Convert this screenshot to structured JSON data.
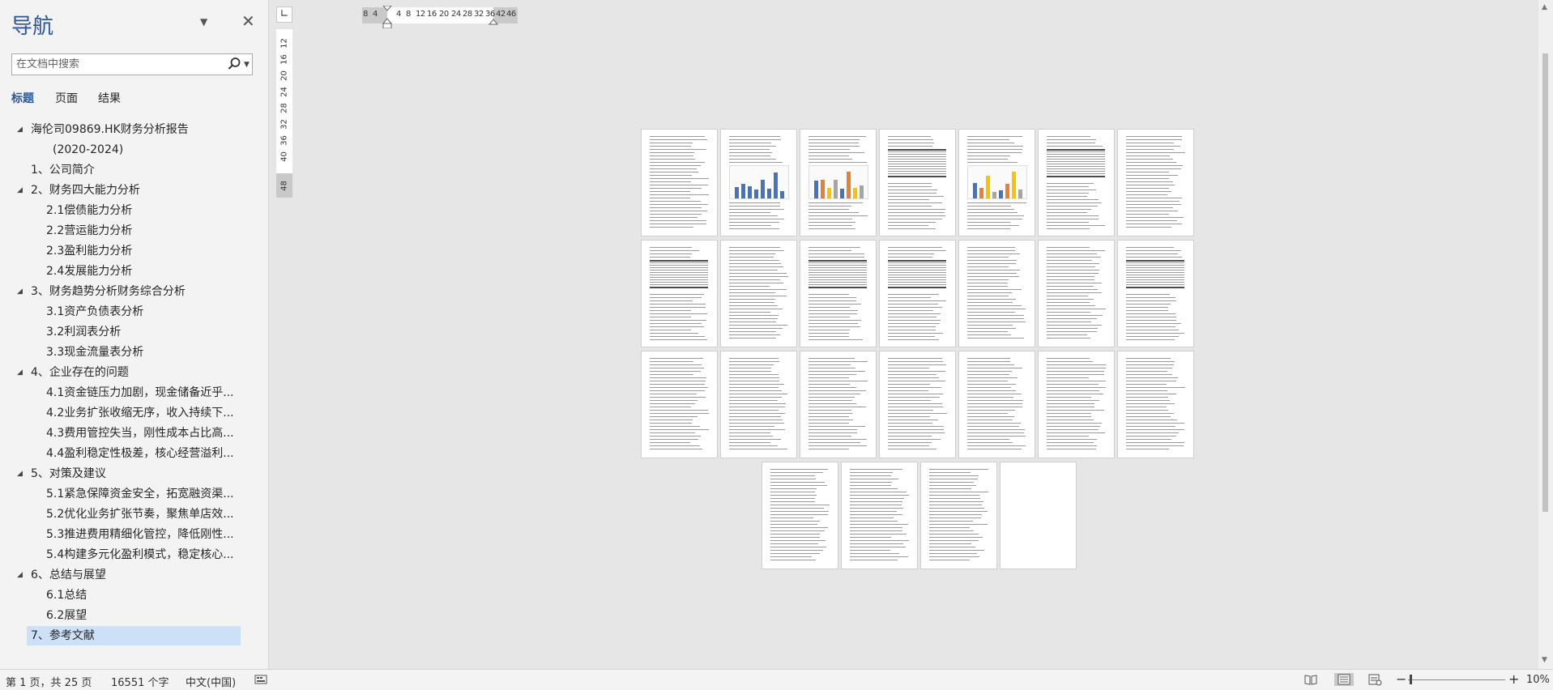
{
  "nav": {
    "title": "导航",
    "search_placeholder": "在文档中搜索",
    "tabs": [
      {
        "label": "标题",
        "active": true
      },
      {
        "label": "页面",
        "active": false
      },
      {
        "label": "结果",
        "active": false
      }
    ],
    "tree": [
      {
        "label": "海伦司09869.HK财务分析报告",
        "level": 1,
        "expanded": true
      },
      {
        "label": "(2020-2024)",
        "level": 1,
        "continuation": true
      },
      {
        "label": "1、公司简介",
        "level": 1
      },
      {
        "label": "2、财务四大能力分析",
        "level": 1,
        "expanded": true
      },
      {
        "label": "2.1偿债能力分析",
        "level": 2
      },
      {
        "label": "2.2营运能力分析",
        "level": 2
      },
      {
        "label": "2.3盈利能力分析",
        "level": 2
      },
      {
        "label": "2.4发展能力分析",
        "level": 2
      },
      {
        "label": "3、财务趋势分析财务综合分析",
        "level": 1,
        "expanded": true
      },
      {
        "label": "3.1资产负债表分析",
        "level": 2
      },
      {
        "label": "3.2利润表分析",
        "level": 2
      },
      {
        "label": "3.3现金流量表分析",
        "level": 2
      },
      {
        "label": "4、企业存在的问题",
        "level": 1,
        "expanded": true
      },
      {
        "label": "4.1资金链压力加剧，现金储备近乎...",
        "level": 2
      },
      {
        "label": "4.2业务扩张收缩无序，收入持续下...",
        "level": 2
      },
      {
        "label": "4.3费用管控失当，刚性成本占比高...",
        "level": 2
      },
      {
        "label": "4.4盈利稳定性极差，核心经营溢利...",
        "level": 2
      },
      {
        "label": "5、对策及建议",
        "level": 1,
        "expanded": true
      },
      {
        "label": "5.1紧急保障资金安全，拓宽融资渠...",
        "level": 2
      },
      {
        "label": "5.2优化业务扩张节奏，聚焦单店效...",
        "level": 2
      },
      {
        "label": "5.3推进费用精细化管控，降低刚性...",
        "level": 2
      },
      {
        "label": "5.4构建多元化盈利模式，稳定核心...",
        "level": 2
      },
      {
        "label": "6、总结与展望",
        "level": 1,
        "expanded": true
      },
      {
        "label": "6.1总结",
        "level": 2
      },
      {
        "label": "6.2展望",
        "level": 2
      },
      {
        "label": "7、参考文献",
        "level": 1,
        "selected": true
      }
    ]
  },
  "rulers": {
    "corner": "∟",
    "horizontal_ticks": [
      "8",
      "4",
      "4",
      "8",
      "12",
      "16",
      "20",
      "24",
      "28",
      "32",
      "36",
      "42",
      "46"
    ],
    "vertical_ticks": [
      "12",
      "16",
      "20",
      "24",
      "28",
      "32",
      "36",
      "40",
      "48"
    ]
  },
  "document": {
    "page_count_visible": 25
  },
  "status": {
    "page_info": "第 1 页，共 25 页",
    "word_count": "16551 个字",
    "language": "中文(中国)",
    "zoom_out": "−",
    "zoom_in": "+",
    "zoom_level": "10%",
    "zoom_fraction": 0.1
  },
  "colors": {
    "accent": "#2b579a",
    "selection": "#cce0f7",
    "chart_blue": "#4472c4",
    "chart_orange": "#ed7d31",
    "chart_gold": "#ffc000",
    "chart_gray": "#a5a5a5"
  },
  "icons": {
    "nav_menu": "chevron-down-icon",
    "nav_close": "close-icon",
    "search": "search-icon",
    "tree_expanded": "triangle-expanded-icon",
    "macro": "macro-recording-icon",
    "read_mode": "read-mode-icon",
    "print_layout": "print-layout-icon",
    "web_layout": "web-layout-icon"
  }
}
